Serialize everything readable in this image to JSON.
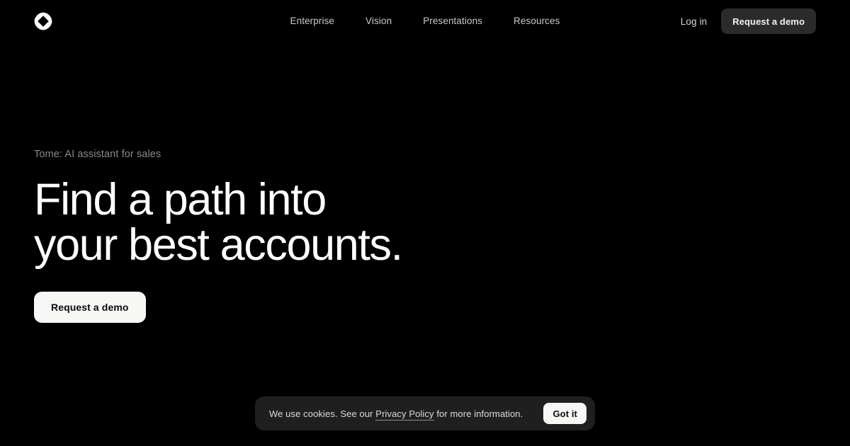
{
  "theme": {
    "background": "#000000",
    "text_primary": "#ffffff",
    "text_muted": "#8b8b8b",
    "nav_link": "#c9c9c9",
    "surface_dark": "#1f1f1f",
    "button_dark": "#2b2b2b",
    "button_light": "#f7f7f5",
    "button_light_text": "#0b0b0b"
  },
  "header": {
    "logo_name": "tome-logo-icon",
    "nav": [
      {
        "label": "Enterprise"
      },
      {
        "label": "Vision"
      },
      {
        "label": "Presentations"
      },
      {
        "label": "Resources"
      }
    ],
    "login_label": "Log in",
    "cta_label": "Request a demo"
  },
  "hero": {
    "eyebrow": "Tome: AI assistant for sales",
    "title": "Find a path into\nyour best accounts.",
    "cta_label": "Request a demo"
  },
  "cookie_banner": {
    "text_before": "We use cookies. See our ",
    "link_label": "Privacy Policy",
    "text_after": " for more information.",
    "accept_label": "Got it"
  }
}
